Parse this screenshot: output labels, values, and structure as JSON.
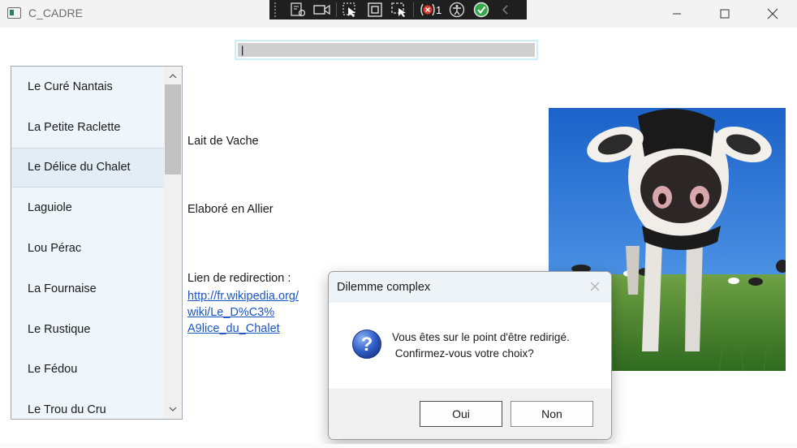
{
  "window": {
    "title": "C_CADRE"
  },
  "search": {
    "value": "|"
  },
  "cheese_list": {
    "items": [
      "Le Curé Nantais",
      "La Petite Raclette",
      "Le Délice du Chalet",
      "Laguiole",
      "Lou Pérac",
      "La Fournaise",
      "Le Rustique",
      "Le Fédou",
      "Le Trou du Cru"
    ],
    "selected": "Le Délice du Chalet"
  },
  "details": {
    "milk": "Lait de Vache",
    "origin": "Elaboré en Allier",
    "link_label": "Lien de redirection :",
    "link_url_lines": [
      "http://fr.wikipedia.org/",
      "wiki/Le_D%C3%",
      "A9lice_du_Chalet"
    ]
  },
  "devtools": {
    "error_count": "1"
  },
  "dialog": {
    "title": "Dilemme complex",
    "message_line1": "Vous êtes sur le point d'être redirigé.",
    "message_line2": " Confirmez-vous votre choix?",
    "yes_label": "Oui",
    "no_label": "Non"
  },
  "colors": {
    "link": "#1a56c4",
    "list_bg": "#eef6fc",
    "dialog_header": "#eef3f8"
  }
}
